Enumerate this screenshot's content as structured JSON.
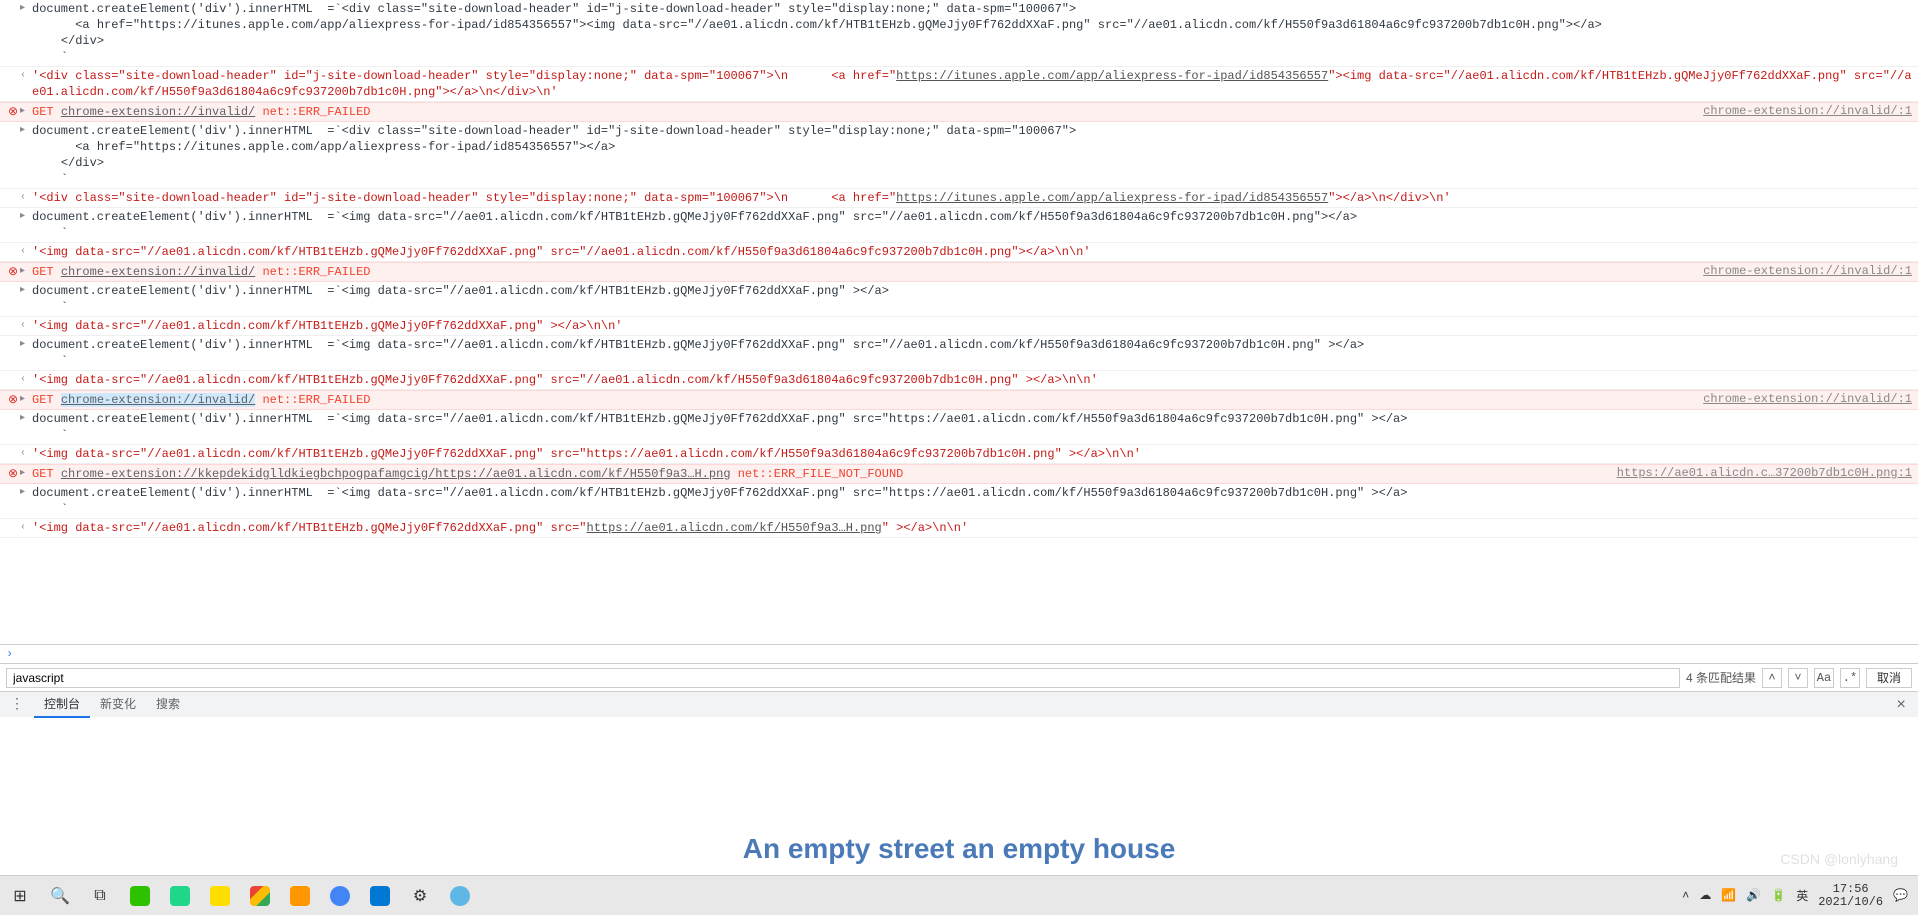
{
  "subtitle": "An empty street an empty house",
  "watermark": "CSDN @lonlyhang",
  "filter": {
    "value": "javascript",
    "count": "4 条匹配结果",
    "cancel": "取消"
  },
  "tabs": {
    "console": "控制台",
    "whatsnew": "新变化",
    "search": "搜索"
  },
  "taskbar": {
    "time": "17:56",
    "date": "2021/10/6",
    "ime": "英"
  },
  "rows": [
    {
      "type": "log",
      "tri": "▸",
      "text": "document.createElement('div').innerHTML  =`<div class=\"site-download-header\" id=\"j-site-download-header\" style=\"display:none;\" data-spm=\"100067\">\n      <a href=\"https://itunes.apple.com/app/aliexpress-for-ipad/id854356557\"><img data-src=\"//ae01.alicdn.com/kf/HTB1tEHzb.gQMeJjy0Ff762ddXXaF.png\" src=\"//ae01.alicdn.com/kf/H550f9a3d61804a6c9fc937200b7db1c0H.png\"></a>\n    </div>\n    `"
    },
    {
      "type": "ret",
      "tri": "‹",
      "text": "'<div class=\"site-download-header\" id=\"j-site-download-header\" style=\"display:none;\" data-spm=\"100067\">\\n      <a href=\"",
      "link": "https://itunes.apple.com/app/aliexpress-for-ipad/id854356557",
      "text2": "\"><img data-src=\"//ae01.alicdn.com/kf/HTB1tEHzb.gQMeJjy0Ff762ddXXaF.png\" src=\"//ae01.alicdn.com/kf/H550f9a3d61804a6c9fc937200b7db1c0H.png\"></a>\\n</div>\\n'"
    },
    {
      "type": "err",
      "tri": "▸",
      "text": "GET ",
      "link": "chrome-extension://invalid/",
      "text2": " net::ERR_FAILED",
      "src": "chrome-extension://invalid/:1"
    },
    {
      "type": "log",
      "tri": "▸",
      "text": "document.createElement('div').innerHTML  =`<div class=\"site-download-header\" id=\"j-site-download-header\" style=\"display:none;\" data-spm=\"100067\">\n      <a href=\"https://itunes.apple.com/app/aliexpress-for-ipad/id854356557\"></a>\n    </div>\n    `"
    },
    {
      "type": "ret",
      "tri": "‹",
      "text": "'<div class=\"site-download-header\" id=\"j-site-download-header\" style=\"display:none;\" data-spm=\"100067\">\\n      <a href=\"",
      "link": "https://itunes.apple.com/app/aliexpress-for-ipad/id854356557",
      "text2": "\"></a>\\n</div>\\n'"
    },
    {
      "type": "log",
      "tri": "▸",
      "text": "document.createElement('div').innerHTML  =`<img data-src=\"//ae01.alicdn.com/kf/HTB1tEHzb.gQMeJjy0Ff762ddXXaF.png\" src=\"//ae01.alicdn.com/kf/H550f9a3d61804a6c9fc937200b7db1c0H.png\"></a>\n    `"
    },
    {
      "type": "ret",
      "tri": "‹",
      "text": "'<img data-src=\"//ae01.alicdn.com/kf/HTB1tEHzb.gQMeJjy0Ff762ddXXaF.png\" src=\"//ae01.alicdn.com/kf/H550f9a3d61804a6c9fc937200b7db1c0H.png\"></a>\\n\\n'"
    },
    {
      "type": "err",
      "tri": "▸",
      "text": "GET ",
      "link": "chrome-extension://invalid/",
      "text2": " net::ERR_FAILED",
      "src": "chrome-extension://invalid/:1"
    },
    {
      "type": "log",
      "tri": "▸",
      "text": "document.createElement('div').innerHTML  =`<img data-src=\"//ae01.alicdn.com/kf/HTB1tEHzb.gQMeJjy0Ff762ddXXaF.png\" ></a>\n    `"
    },
    {
      "type": "ret",
      "tri": "‹",
      "text": "'<img data-src=\"//ae01.alicdn.com/kf/HTB1tEHzb.gQMeJjy0Ff762ddXXaF.png\" ></a>\\n\\n'"
    },
    {
      "type": "log",
      "tri": "▸",
      "text": "document.createElement('div').innerHTML  =`<img data-src=\"//ae01.alicdn.com/kf/HTB1tEHzb.gQMeJjy0Ff762ddXXaF.png\" src=\"//ae01.alicdn.com/kf/H550f9a3d61804a6c9fc937200b7db1c0H.png\" ></a>\n    `"
    },
    {
      "type": "ret",
      "tri": "‹",
      "text": "'<img data-src=\"//ae01.alicdn.com/kf/HTB1tEHzb.gQMeJjy0Ff762ddXXaF.png\" src=\"//ae01.alicdn.com/kf/H550f9a3d61804a6c9fc937200b7db1c0H.png\" ></a>\\n\\n'"
    },
    {
      "type": "err",
      "tri": "▸",
      "text": "GET ",
      "link": "chrome-extension://invalid/",
      "text2": " net::ERR_FAILED",
      "src": "chrome-extension://invalid/:1",
      "hl": true
    },
    {
      "type": "log",
      "tri": "▸",
      "text": "document.createElement('div').innerHTML  =`<img data-src=\"//ae01.alicdn.com/kf/HTB1tEHzb.gQMeJjy0Ff762ddXXaF.png\" src=\"https://ae01.alicdn.com/kf/H550f9a3d61804a6c9fc937200b7db1c0H.png\" ></a>\n    `"
    },
    {
      "type": "ret",
      "tri": "‹",
      "text": "'<img data-src=\"//ae01.alicdn.com/kf/HTB1tEHzb.gQMeJjy0Ff762ddXXaF.png\" src=\"https://ae01.alicdn.com/kf/H550f9a3d61804a6c9fc937200b7db1c0H.png\" ></a>\\n\\n'"
    },
    {
      "type": "err",
      "tri": "▸",
      "text": "GET ",
      "link": "chrome-extension://kkepdekidglldkiegbchpogpafamgcig/https://ae01.alicdn.com/kf/H550f9a3…H.png",
      "text2": " net::ERR_FILE_NOT_FOUND",
      "src": "https://ae01.alicdn.c…37200b7db1c0H.png:1"
    },
    {
      "type": "log",
      "tri": "▸",
      "text": "document.createElement('div').innerHTML  =`<img data-src=\"//ae01.alicdn.com/kf/HTB1tEHzb.gQMeJjy0Ff762ddXXaF.png\" src=\"https://ae01.alicdn.com/kf/H550f9a3d61804a6c9fc937200b7db1c0H.png\" ></a>\n    `"
    },
    {
      "type": "ret",
      "tri": "‹",
      "text": "'<img data-src=\"//ae01.alicdn.com/kf/HTB1tEHzb.gQMeJjy0Ff762ddXXaF.png\" src=\"",
      "link": "https://ae01.alicdn.com/kf/H550f9a3…H.png",
      "text2": "\" ></a>\\n\\n'"
    }
  ]
}
